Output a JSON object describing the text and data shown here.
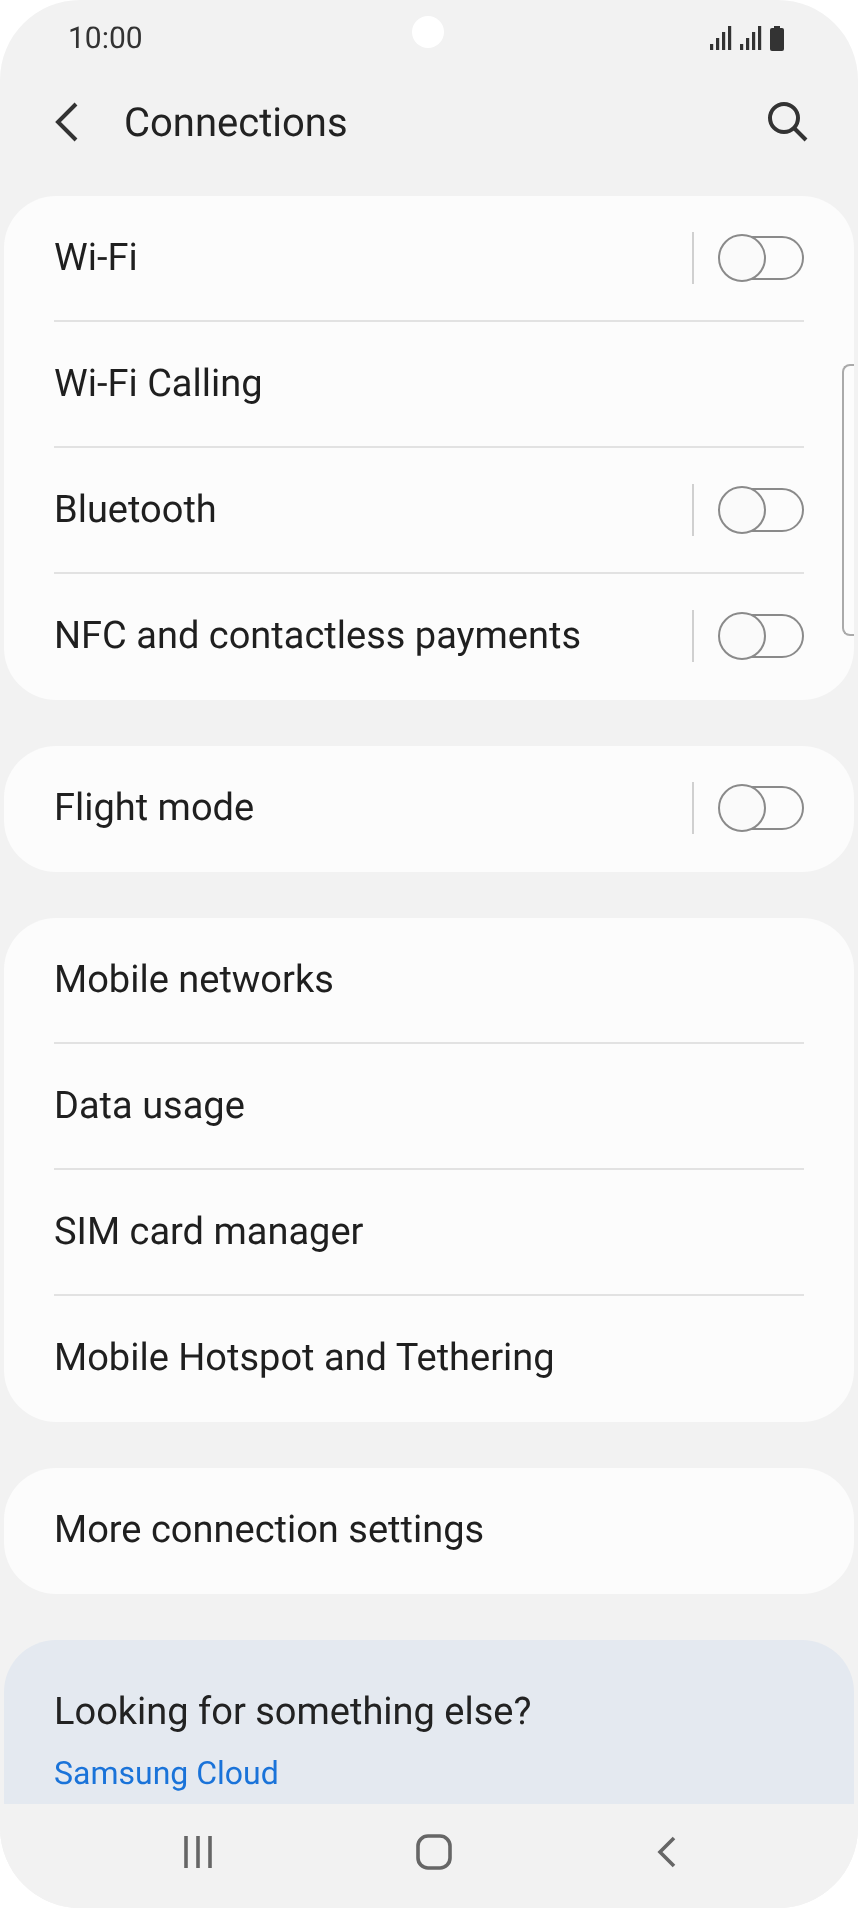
{
  "status_bar": {
    "time": "10:00"
  },
  "header": {
    "title": "Connections"
  },
  "groups": [
    {
      "items": [
        {
          "label": "Wi-Fi",
          "kind": "toggle",
          "on": false
        },
        {
          "label": "Wi-Fi Calling",
          "kind": "link"
        },
        {
          "label": "Bluetooth",
          "kind": "toggle",
          "on": false
        },
        {
          "label": "NFC and contactless payments",
          "kind": "toggle",
          "on": false
        }
      ]
    },
    {
      "items": [
        {
          "label": "Flight mode",
          "kind": "toggle",
          "on": false
        }
      ]
    },
    {
      "items": [
        {
          "label": "Mobile networks",
          "kind": "link"
        },
        {
          "label": "Data usage",
          "kind": "link"
        },
        {
          "label": "SIM card manager",
          "kind": "link"
        },
        {
          "label": "Mobile Hotspot and Tethering",
          "kind": "link"
        }
      ]
    },
    {
      "items": [
        {
          "label": "More connection settings",
          "kind": "link"
        }
      ]
    }
  ],
  "suggestions": {
    "title": "Looking for something else?",
    "links": [
      "Samsung Cloud"
    ]
  }
}
